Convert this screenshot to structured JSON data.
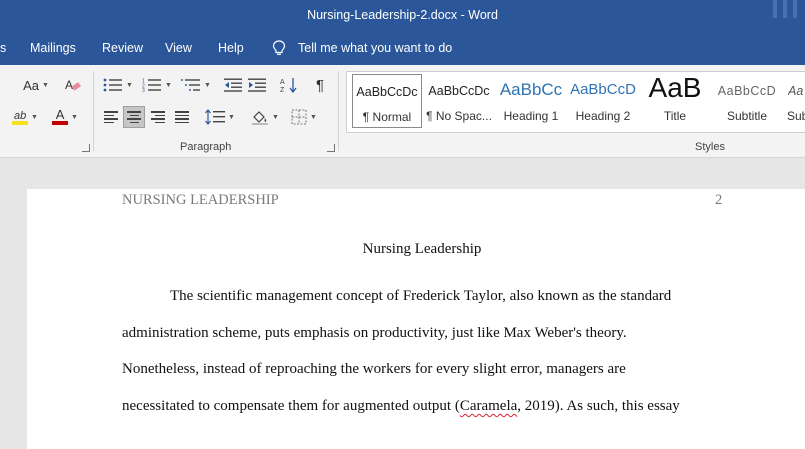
{
  "window": {
    "title": "Nursing-Leadership-2.docx  -  Word"
  },
  "menu": {
    "tabs": [
      "s",
      "Mailings",
      "Review",
      "View",
      "Help"
    ],
    "tell_me": "Tell me what you want to do"
  },
  "ribbon": {
    "paragraph_label": "Paragraph",
    "styles_label": "Styles",
    "font": {
      "change_case": "Aa",
      "highlight_color": "#f7e11a",
      "font_color": "#c00000"
    },
    "styles": [
      {
        "preview": "AaBbCcDc",
        "name": "¶ Normal"
      },
      {
        "preview": "AaBbCcDc",
        "name": "¶ No Spac..."
      },
      {
        "preview": "AaBbCc",
        "name": "Heading 1"
      },
      {
        "preview": "AaBbCcD",
        "name": "Heading 2"
      },
      {
        "preview": "AaB",
        "name": "Title"
      },
      {
        "preview": "AaBbCcD",
        "name": "Subtitle"
      },
      {
        "preview": "Aa",
        "name": "Sub"
      }
    ]
  },
  "document": {
    "running_head": "NURSING LEADERSHIP",
    "page_number": "2",
    "heading": "Nursing Leadership",
    "lines": [
      "The scientific management concept of Frederick Taylor, also known as the standard",
      "administration scheme, puts emphasis on productivity, just like Max Weber's theory.",
      "Nonetheless, instead of reproaching the workers for every slight error, managers are"
    ],
    "last_line": {
      "before": "necessitated to compensate them for augmented output (",
      "flagged": "Caramela",
      "after": ", 2019). As such, this essay"
    }
  }
}
